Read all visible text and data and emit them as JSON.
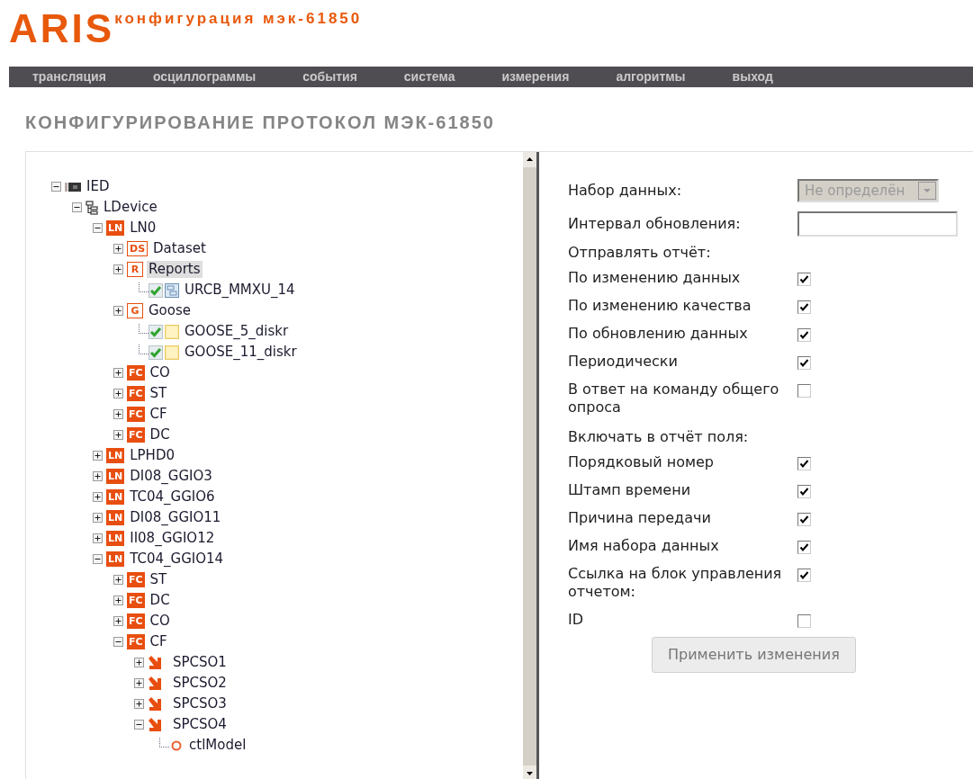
{
  "header": {
    "logo": "ARIS",
    "subtitle": "конфигурация мэк-61850"
  },
  "nav": [
    {
      "label": "трансляция"
    },
    {
      "label": "осциллограммы"
    },
    {
      "label": "события"
    },
    {
      "label": "система"
    },
    {
      "label": "измерения"
    },
    {
      "label": "алгоритмы"
    },
    {
      "label": "выход"
    }
  ],
  "page_title": "КОНФИГУРИРОВАНИЕ ПРОТОКОЛ МЭК-61850",
  "tree": [
    {
      "kind": "ied",
      "label": "IED",
      "expanded": true,
      "selected": false,
      "children": [
        {
          "kind": "ldevice",
          "label": "LDevice",
          "expanded": true,
          "selected": false,
          "children": [
            {
              "kind": "badge",
              "badge": "LN",
              "label": "LN0",
              "expanded": true,
              "selected": false,
              "children": [
                {
                  "kind": "outline",
                  "badge": "DS",
                  "label": "Dataset",
                  "expanded": false,
                  "selected": false
                },
                {
                  "kind": "outline",
                  "badge": "R",
                  "label": "Reports",
                  "expanded": false,
                  "selected": true,
                  "children": [
                    {
                      "kind": "report",
                      "label": "URCB_MMXU_14",
                      "checked": true,
                      "selected": false
                    }
                  ]
                },
                {
                  "kind": "outline",
                  "badge": "G",
                  "label": "Goose",
                  "expanded": false,
                  "selected": false,
                  "children": [
                    {
                      "kind": "goose",
                      "label": "GOOSE_5_diskr",
                      "checked": true,
                      "selected": false
                    },
                    {
                      "kind": "goose",
                      "label": "GOOSE_11_diskr",
                      "checked": true,
                      "selected": false
                    }
                  ]
                },
                {
                  "kind": "badge",
                  "badge": "FC",
                  "label": "CO",
                  "expanded": false,
                  "selected": false
                },
                {
                  "kind": "badge",
                  "badge": "FC",
                  "label": "ST",
                  "expanded": false,
                  "selected": false
                },
                {
                  "kind": "badge",
                  "badge": "FC",
                  "label": "CF",
                  "expanded": false,
                  "selected": false
                },
                {
                  "kind": "badge",
                  "badge": "FC",
                  "label": "DC",
                  "expanded": false,
                  "selected": false
                }
              ]
            },
            {
              "kind": "badge",
              "badge": "LN",
              "label": "LPHD0",
              "expanded": false,
              "selected": false
            },
            {
              "kind": "badge",
              "badge": "LN",
              "label": "DI08_GGIO3",
              "expanded": false,
              "selected": false
            },
            {
              "kind": "badge",
              "badge": "LN",
              "label": "TC04_GGIO6",
              "expanded": false,
              "selected": false
            },
            {
              "kind": "badge",
              "badge": "LN",
              "label": "DI08_GGIO11",
              "expanded": false,
              "selected": false
            },
            {
              "kind": "badge",
              "badge": "LN",
              "label": "II08_GGIO12",
              "expanded": false,
              "selected": false
            },
            {
              "kind": "badge",
              "badge": "LN",
              "label": "TC04_GGIO14",
              "expanded": true,
              "selected": false,
              "children": [
                {
                  "kind": "badge",
                  "badge": "FC",
                  "label": "ST",
                  "expanded": false,
                  "selected": false
                },
                {
                  "kind": "badge",
                  "badge": "FC",
                  "label": "DC",
                  "expanded": false,
                  "selected": false
                },
                {
                  "kind": "badge",
                  "badge": "FC",
                  "label": "CO",
                  "expanded": false,
                  "selected": false
                },
                {
                  "kind": "badge",
                  "badge": "FC",
                  "label": "CF",
                  "expanded": true,
                  "selected": false,
                  "children": [
                    {
                      "kind": "arrow",
                      "label": "SPCSO1",
                      "expanded": false,
                      "selected": false
                    },
                    {
                      "kind": "arrow",
                      "label": "SPCSO2",
                      "expanded": false,
                      "selected": false
                    },
                    {
                      "kind": "arrow",
                      "label": "SPCSO3",
                      "expanded": false,
                      "selected": false
                    },
                    {
                      "kind": "arrow",
                      "label": "SPCSO4",
                      "expanded": true,
                      "selected": false,
                      "children": [
                        {
                          "kind": "circle",
                          "label": "ctlModel",
                          "selected": false
                        }
                      ]
                    }
                  ]
                }
              ]
            }
          ]
        }
      ]
    }
  ],
  "form": {
    "dataset": {
      "label": "Набор данных:",
      "value": "Не определён",
      "disabled": true
    },
    "interval": {
      "label": "Интервал обновления:"
    },
    "send_report": {
      "title": "Отправлять отчёт:",
      "options": [
        {
          "label": "По изменению данных",
          "checked": true
        },
        {
          "label": "По изменению качества",
          "checked": true
        },
        {
          "label": "По обновлению данных",
          "checked": true
        },
        {
          "label": "Периодически",
          "checked": true
        },
        {
          "label": "В ответ на команду общего опроса",
          "checked": false
        }
      ]
    },
    "include_fields": {
      "title": "Включать в отчёт поля:",
      "options": [
        {
          "label": "Порядковый номер",
          "checked": true
        },
        {
          "label": "Штамп времени",
          "checked": true
        },
        {
          "label": "Причина передачи",
          "checked": true
        },
        {
          "label": "Имя набора данных",
          "checked": true
        },
        {
          "label": "Ссылка на блок управления отчетом:",
          "checked": true
        },
        {
          "label": "ID",
          "checked": false
        }
      ]
    },
    "apply_button": "Применить изменения"
  }
}
